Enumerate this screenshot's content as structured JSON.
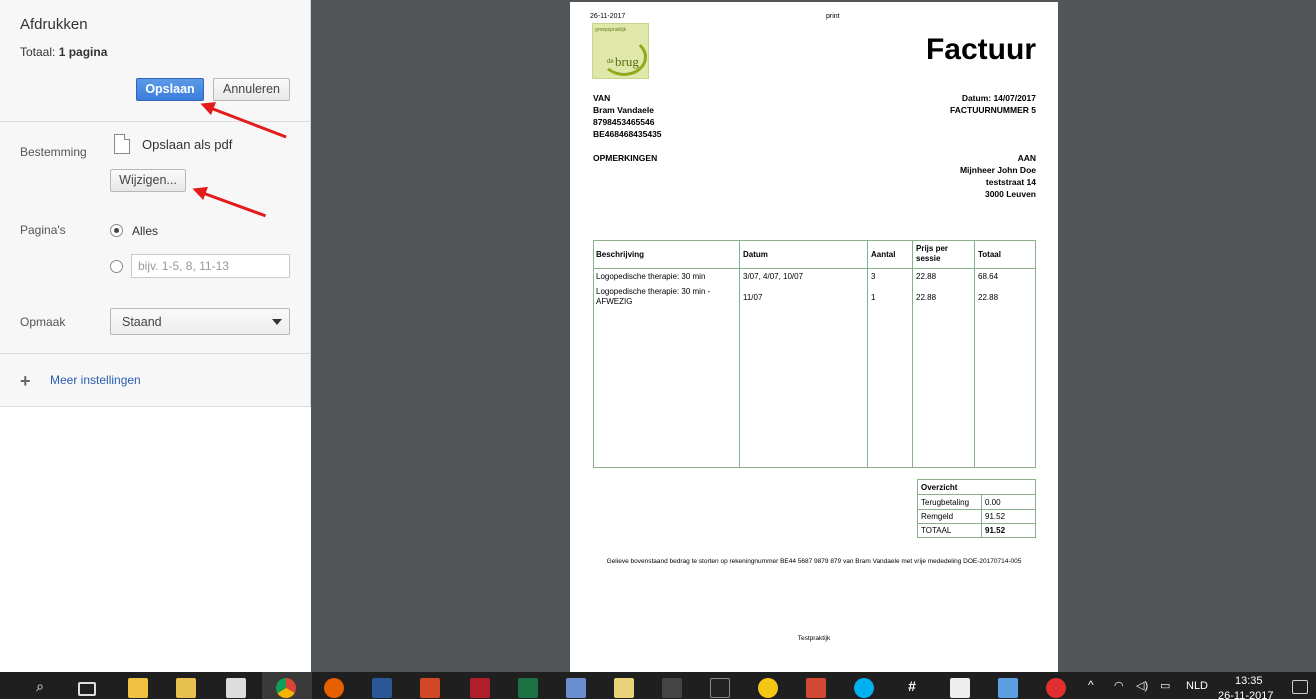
{
  "print_panel": {
    "title": "Afdrukken",
    "total_label": "Totaal:",
    "total_value": "1 pagina",
    "save_label": "Opslaan",
    "cancel_label": "Annuleren",
    "destination_label": "Bestemming",
    "destination_value": "Opslaan als pdf",
    "change_label": "Wijzigen...",
    "pages_label": "Pagina's",
    "pages_all_label": "Alles",
    "pages_custom_placeholder": "bijv. 1-5, 8, 11-13",
    "layout_label": "Opmaak",
    "layout_value": "Staand",
    "more_settings_label": "Meer instellingen"
  },
  "document": {
    "header_date": "26-11-2017",
    "header_center": "print",
    "logo_small": "groepspraktijk",
    "logo_de": "de",
    "logo_name": "brug",
    "title": "Factuur",
    "from_heading": "VAN",
    "from_name": "Bram Vandaele",
    "from_phone": "8798453465546",
    "from_vat": "BE468468435435",
    "date_line": "Datum: 14/07/2017",
    "invoice_number": "FACTUURNUMMER 5",
    "remarks_heading": "OPMERKINGEN",
    "to_heading": "AAN",
    "to_name": "Mijnheer John Doe",
    "to_street": "teststraat 14",
    "to_city": "3000 Leuven",
    "table": {
      "headers": [
        "Beschrijving",
        "Datum",
        "Aantal",
        "Prijs per sessie",
        "Totaal"
      ],
      "rows": [
        [
          "Logopedische therapie: 30 min",
          "3/07, 4/07, 10/07",
          "3",
          "22.88",
          "68.64"
        ],
        [
          "Logopedische therapie: 30 min - AFWEZIG",
          "11/07",
          "1",
          "22.88",
          "22.88"
        ]
      ]
    },
    "overview": {
      "title": "Overzicht",
      "rows": [
        [
          "Terugbetaling",
          "0.00"
        ],
        [
          "Remgeld",
          "91.52"
        ],
        [
          "TOTAAL",
          "91.52"
        ]
      ]
    },
    "payment_note": "Gelieve bovenstaand bedrag te storten op rekeningnummer BE44 5687 9879 879 van Bram Vandaele met vrije mededeling DOE-20170714-005",
    "footer": "Testpraktijk"
  },
  "taskbar": {
    "language": "NLD",
    "time": "13:35",
    "date": "26-11-2017"
  },
  "colors": {
    "accent_blue": "#3a7ddb",
    "arrow_red": "#e31b1b",
    "table_border": "#8ab08a",
    "viewer_bg": "#525659"
  }
}
